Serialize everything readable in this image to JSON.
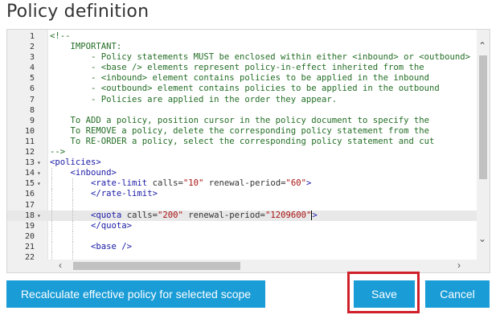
{
  "page": {
    "title": "Policy definition"
  },
  "editor": {
    "lines": [
      {
        "n": "1",
        "fold": "",
        "indent": 0,
        "html": "<span class='cmt'>&lt;!--</span>"
      },
      {
        "n": "2",
        "fold": "",
        "indent": 0,
        "html": "<span class='cmt'>    IMPORTANT:</span>"
      },
      {
        "n": "3",
        "fold": "",
        "indent": 0,
        "html": "<span class='cmt'>        - Policy statements MUST be enclosed within either &lt;inbound&gt; or &lt;outbound&gt;</span>"
      },
      {
        "n": "4",
        "fold": "",
        "indent": 0,
        "html": "<span class='cmt'>        - &lt;base /&gt; elements represent policy-in-effect inherited from the</span>"
      },
      {
        "n": "5",
        "fold": "",
        "indent": 0,
        "html": "<span class='cmt'>        - &lt;inbound&gt; element contains policies to be applied in the inbound</span>"
      },
      {
        "n": "6",
        "fold": "",
        "indent": 0,
        "html": "<span class='cmt'>        - &lt;outbound&gt; element contains policies to be applied in the outbound</span>"
      },
      {
        "n": "7",
        "fold": "",
        "indent": 0,
        "html": "<span class='cmt'>        - Policies are applied in the order they appear.</span>"
      },
      {
        "n": "8",
        "fold": "",
        "indent": 0,
        "html": ""
      },
      {
        "n": "9",
        "fold": "",
        "indent": 0,
        "html": "<span class='cmt'>    To ADD a policy, position cursor in the policy document to specify the</span>"
      },
      {
        "n": "10",
        "fold": "",
        "indent": 0,
        "html": "<span class='cmt'>    To REMOVE a policy, delete the corresponding policy statement from the</span>"
      },
      {
        "n": "11",
        "fold": "",
        "indent": 0,
        "html": "<span class='cmt'>    To RE-ORDER a policy, select the corresponding policy statement and cut</span>"
      },
      {
        "n": "12",
        "fold": "",
        "indent": 0,
        "html": "<span class='cmt'>--&gt;</span>"
      },
      {
        "n": "13",
        "fold": "▾",
        "indent": 0,
        "html": "<span class='tag'>&lt;policies&gt;</span>"
      },
      {
        "n": "14",
        "fold": "▾",
        "indent": 1,
        "html": "    <span class='tag'>&lt;inbound&gt;</span>"
      },
      {
        "n": "15",
        "fold": "▾",
        "indent": 2,
        "html": "        <span class='tag'>&lt;rate-limit</span> <span class='attr'>calls=</span><span class='val'>\"10\"</span> <span class='attr'>renewal-period=</span><span class='val'>\"60\"</span><span class='tag'>&gt;</span>"
      },
      {
        "n": "16",
        "fold": "",
        "indent": 2,
        "html": "        <span class='tag'>&lt;/rate-limit&gt;</span>"
      },
      {
        "n": "17",
        "fold": "",
        "indent": 2,
        "html": ""
      },
      {
        "n": "18",
        "fold": "▾",
        "indent": 2,
        "active": true,
        "html": "        <span class='tag'>&lt;quota</span> <span class='attr'>calls=</span><span class='val'>\"200\"</span> <span class='attr'>renewal-period=</span><span class='val'>\"1209600\"</span><span class='caret'></span><span class='tag'>&gt;</span>"
      },
      {
        "n": "19",
        "fold": "",
        "indent": 2,
        "html": "        <span class='tag'>&lt;/quota&gt;</span>"
      },
      {
        "n": "20",
        "fold": "",
        "indent": 2,
        "html": ""
      },
      {
        "n": "21",
        "fold": "",
        "indent": 2,
        "html": "        <span class='tag'>&lt;base /&gt;</span>"
      },
      {
        "n": "22",
        "fold": "",
        "indent": 2,
        "html": ""
      }
    ]
  },
  "buttons": {
    "recalculate": "Recalculate effective policy for selected scope",
    "save": "Save",
    "cancel": "Cancel"
  },
  "icons": {
    "scroll_up": "chevron-up-icon",
    "scroll_down": "chevron-down-icon",
    "scroll_left": "chevron-left-icon",
    "scroll_right": "chevron-right-icon"
  },
  "colors": {
    "accent": "#1a9cd7",
    "highlight_frame": "#d0202a"
  }
}
